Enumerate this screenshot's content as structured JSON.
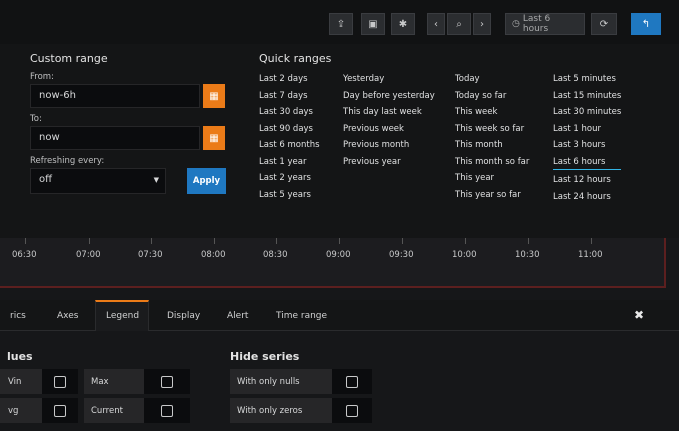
{
  "toolbar": {
    "timepicker_label": "Last 6 hours",
    "share_icon": "share-icon",
    "save_icon": "save-icon",
    "settings_icon": "gear-icon",
    "zoom_icon": "search-icon",
    "refresh_icon": "refresh-icon",
    "back_icon": "back-arrow-icon"
  },
  "custom_range": {
    "title": "Custom range",
    "from_label": "From:",
    "from_value": "now-6h",
    "to_label": "To:",
    "to_value": "now",
    "refresh_label": "Refreshing every:",
    "refresh_value": "off",
    "apply_label": "Apply"
  },
  "quick_ranges": {
    "title": "Quick ranges",
    "columns": [
      [
        "Last 2 days",
        "Last 7 days",
        "Last 30 days",
        "Last 90 days",
        "Last 6 months",
        "Last 1 year",
        "Last 2 years",
        "Last 5 years"
      ],
      [
        "Yesterday",
        "Day before yesterday",
        "This day last week",
        "Previous week",
        "Previous month",
        "Previous year"
      ],
      [
        "Today",
        "Today so far",
        "This week",
        "This week so far",
        "This month",
        "This month so far",
        "This year",
        "This year so far"
      ],
      [
        "Last 5 minutes",
        "Last 15 minutes",
        "Last 30 minutes",
        "Last 1 hour",
        "Last 3 hours",
        "Last 6 hours",
        "Last 12 hours",
        "Last 24 hours"
      ]
    ],
    "active": "Last 6 hours"
  },
  "graph": {
    "ticks": [
      "06:30",
      "07:00",
      "07:30",
      "08:00",
      "08:30",
      "09:00",
      "09:30",
      "10:00",
      "10:30",
      "11:00"
    ]
  },
  "tabs": [
    "rics",
    "Axes",
    "Legend",
    "Display",
    "Alert",
    "Time range"
  ],
  "values_group": {
    "title": "lues",
    "rows": [
      [
        {
          "label": "Min",
          "shown": "Vin"
        },
        {
          "label": "Max",
          "shown": "Max"
        }
      ],
      [
        {
          "label": "Avg",
          "shown": "vg"
        },
        {
          "label": "Current",
          "shown": "Current"
        }
      ]
    ]
  },
  "hide_series": {
    "title": "Hide series",
    "items": [
      "With only nulls",
      "With only zeros"
    ]
  },
  "colors": {
    "accent_orange": "#eb7b18",
    "accent_blue": "#1f78c1",
    "active_underline": "#33b5e5"
  }
}
